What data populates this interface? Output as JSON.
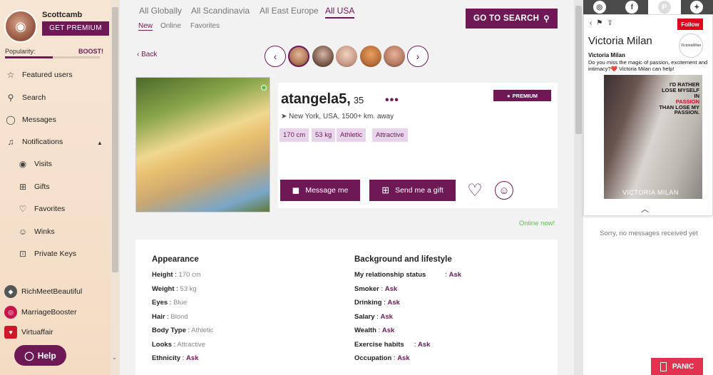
{
  "sidebar": {
    "username": "Scottcamb",
    "premium_label": "GET PREMIUM",
    "popularity_label": "Popularity:",
    "boost_label": "BOOST!",
    "popularity_level": 0.5,
    "nav": [
      {
        "label": "Featured users",
        "icon": "star-icon"
      },
      {
        "label": "Search",
        "icon": "search-icon"
      },
      {
        "label": "Messages",
        "icon": "chat-icon"
      },
      {
        "label": "Notifications",
        "icon": "bell-icon"
      }
    ],
    "notifications_sub": [
      {
        "label": "Visits",
        "icon": "eye-icon"
      },
      {
        "label": "Gifts",
        "icon": "gift-icon"
      },
      {
        "label": "Favorites",
        "icon": "heart-icon"
      },
      {
        "label": "Winks",
        "icon": "smiley-icon"
      },
      {
        "label": "Private Keys",
        "icon": "lock-icon"
      }
    ],
    "external": [
      {
        "label": "RichMeetBeautiful",
        "color": "#555555"
      },
      {
        "label": "MarriageBooster",
        "color": "#c8144c"
      },
      {
        "label": "Virtuaffair",
        "color": "#cc1a2a"
      }
    ],
    "help_label": "Help"
  },
  "main": {
    "tabs": [
      "All Globally",
      "All Scandinavia",
      "All East Europe",
      "All USA"
    ],
    "subtabs": [
      "New",
      "Online",
      "Favorites"
    ],
    "goto_search_label": "GO TO SEARCH",
    "back_label": "Back",
    "profile": {
      "name": "atangela5,",
      "age": "35",
      "premium_badge": "PREMIUM",
      "location": "New York, USA, 1500+ km. away",
      "tags": [
        "170 cm",
        "53 kg",
        "Athletic",
        "Attractive"
      ],
      "message_label": "Message me",
      "gift_label": "Send me a gift",
      "online_status": "Online now!"
    },
    "appearance": {
      "title": "Appearance",
      "rows": [
        {
          "label": "Height",
          "value": "170 cm",
          "ask": false
        },
        {
          "label": "Weight",
          "value": "53 kg",
          "ask": false
        },
        {
          "label": "Eyes",
          "value": "Blue",
          "ask": false
        },
        {
          "label": "Hair",
          "value": "Blond",
          "ask": false
        },
        {
          "label": "Body Type",
          "value": "Athletic",
          "ask": false
        },
        {
          "label": "Looks",
          "value": "Attractive",
          "ask": false
        },
        {
          "label": "Ethnicity",
          "value": "Ask",
          "ask": true
        }
      ]
    },
    "background": {
      "title": "Background and lifestyle",
      "rows": [
        {
          "label": "My relationship status",
          "value": "Ask"
        },
        {
          "label": "Smoker",
          "value": "Ask"
        },
        {
          "label": "Drinking",
          "value": "Ask"
        },
        {
          "label": "Salary",
          "value": "Ask"
        },
        {
          "label": "Wealth",
          "value": "Ask"
        },
        {
          "label": "Exercise habits",
          "value": "Ask"
        },
        {
          "label": "Occupation",
          "value": "Ask"
        }
      ]
    }
  },
  "right": {
    "social": [
      "instagram-icon",
      "facebook-icon",
      "pinterest-icon",
      "twitter-icon"
    ],
    "ad": {
      "follow_label": "Follow",
      "title": "Victoria Milan",
      "name": "Victoria Milan",
      "text": "Do you miss the magic of passion, excitement and intimacy?❤️ Victoria Milan can help!",
      "tagline_1": "I'D RATHER LOSE MYSELF IN",
      "tagline_red": "PASSION",
      "tagline_2": "THAN LOSE MY PASSION.",
      "brand": "VICTORIA MILAN",
      "logo_text": "VictoriaMilan"
    },
    "no_messages": "Sorry, no messages received yet"
  },
  "panic_label": "PANIC"
}
